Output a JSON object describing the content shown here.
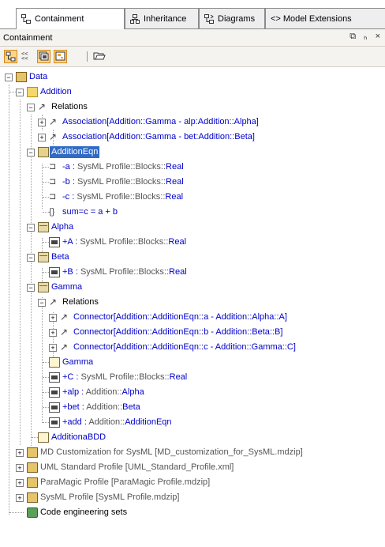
{
  "tabs": [
    {
      "label": "Containment",
      "active": true,
      "icon": "containment-icon"
    },
    {
      "label": "Inheritance",
      "active": false,
      "icon": "inheritance-icon"
    },
    {
      "label": "Diagrams",
      "active": false,
      "icon": "diagrams-icon"
    },
    {
      "label": "Model Extensions",
      "active": false,
      "icon": "model-extensions-icon"
    }
  ],
  "model_extensions_glyph": "<>",
  "panel": {
    "title": "Containment",
    "restore_glyph": "⧉",
    "pin_glyph": "ₕ",
    "close_glyph": "×"
  },
  "toolbar": {
    "expand_glyph": "⊞",
    "separator_glyph": "–"
  },
  "tree": {
    "data": "Data",
    "addition": "Addition",
    "relations1": "Relations",
    "assoc1": "Association[Addition::Gamma - alp:Addition::Alpha]",
    "assoc2": "Association[Addition::Gamma - bet:Addition::Beta]",
    "addition_eqn": "AdditionEqn",
    "p_a_name": "-a :",
    "p_a_type_path": "SysML Profile::Blocks::",
    "p_a_type": "Real",
    "p_b_name": "-b :",
    "p_b_type_path": "SysML Profile::Blocks::",
    "p_b_type": "Real",
    "p_c_name": "-c :",
    "p_c_type_path": "SysML Profile::Blocks::",
    "p_c_type": "Real",
    "constraint": "sum=c = a + b",
    "alpha": "Alpha",
    "a_name": "+A :",
    "a_type_path": "SysML Profile::Blocks::",
    "a_type": "Real",
    "beta": "Beta",
    "b_name": "+B :",
    "b_type_path": "SysML Profile::Blocks::",
    "b_type": "Real",
    "gamma": "Gamma",
    "relations2": "Relations",
    "conn1": "Connector[Addition::AdditionEqn::a - Addition::Alpha::A]",
    "conn2": "Connector[Addition::AdditionEqn::b - Addition::Beta::B]",
    "conn3": "Connector[Addition::AdditionEqn::c - Addition::Gamma::C]",
    "gamma_diag": "Gamma",
    "c_name": "+C :",
    "c_type_path": "SysML Profile::Blocks::",
    "c_type": "Real",
    "alp_name": "+alp :",
    "alp_type_path": "Addition::",
    "alp_type": "Alpha",
    "bet_name": "+bet :",
    "bet_type_path": "Addition::",
    "bet_type": "Beta",
    "add_name": "+add :",
    "add_type_path": "Addition::",
    "add_type": "AdditionEqn",
    "bdd": "AdditionaBDD",
    "md_custom": "MD Customization for SysML [MD_customization_for_SysML.mdzip]",
    "uml_std": "UML Standard Profile [UML_Standard_Profile.xml]",
    "paramagic": "ParaMagic Profile  [ParaMagic Profile.mdzip]",
    "sysml": "SysML Profile [SysML Profile.mdzip]",
    "code_sets": "Code engineering sets"
  },
  "colors": {
    "link_blue": "#0000cc",
    "selection": "#316ac5",
    "profile_gray": "#555555"
  }
}
